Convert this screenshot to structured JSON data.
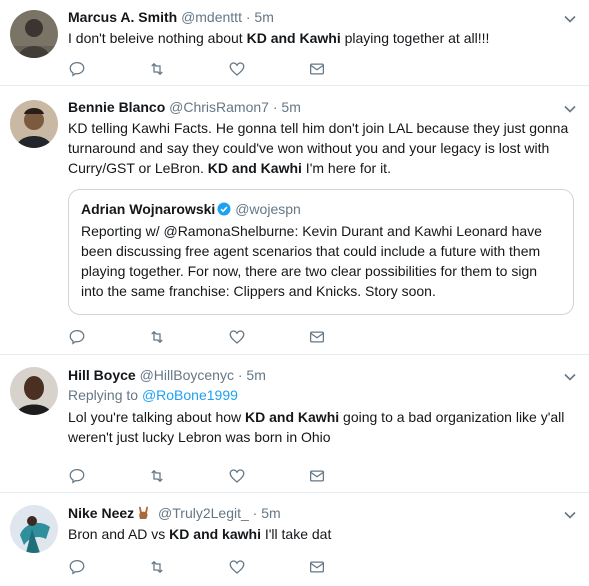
{
  "tweets": [
    {
      "name": "Marcus A. Smith",
      "handle": "@mdenttt",
      "dot": "·",
      "time": "5m",
      "text_before": "I don't beleive nothing about ",
      "text_bold": "KD and Kawhi",
      "text_after": " playing together at all!!!"
    },
    {
      "name": "Bennie Blanco",
      "handle": "@ChrisRamon7",
      "dot": "·",
      "time": "5m",
      "text_before": "KD telling Kawhi Facts. He gonna tell him don't join LAL because they just gonna turnaround and say they could've won without you and your legacy is lost with Curry/GST or LeBron. ",
      "text_bold": "KD and Kawhi",
      "text_after": " I'm here for it.",
      "quote": {
        "name": "Adrian Wojnarowski",
        "handle": "@wojespn",
        "text": "Reporting w/ @RamonaShelburne: Kevin Durant and Kawhi Leonard have been discussing free agent scenarios that could include a future with them playing together. For now, there are two clear possibilities for them to sign into the same franchise: Clippers and Knicks. Story soon."
      }
    },
    {
      "name": "Hill Boyce",
      "handle": "@HillBoycenyc",
      "dot": "·",
      "time": "5m",
      "replying_label": "Replying to ",
      "replying_handle": "@RoBone1999",
      "text_before": "Lol you're talking about how ",
      "text_bold": "KD and Kawhi",
      "text_after": " going to a bad organization like y'all weren't just lucky Lebron was born in Ohio"
    },
    {
      "name": "Nike Neez",
      "handle": "@Truly2Legit_",
      "dot": "·",
      "time": "5m",
      "name_emoji": "horns-hand-emoji",
      "text_before": "Bron and AD vs ",
      "text_bold": "KD and kawhi",
      "text_after": " I'll take dat"
    }
  ],
  "icons": {
    "reply": "reply-icon",
    "retweet": "retweet-icon",
    "like": "heart-icon",
    "dm": "envelope-icon",
    "more": "chevron-down-icon"
  },
  "colors": {
    "text": "#14171a",
    "muted": "#657786",
    "link": "#1da1f2",
    "verified": "#1da1f2",
    "border": "#e6ecf0"
  }
}
